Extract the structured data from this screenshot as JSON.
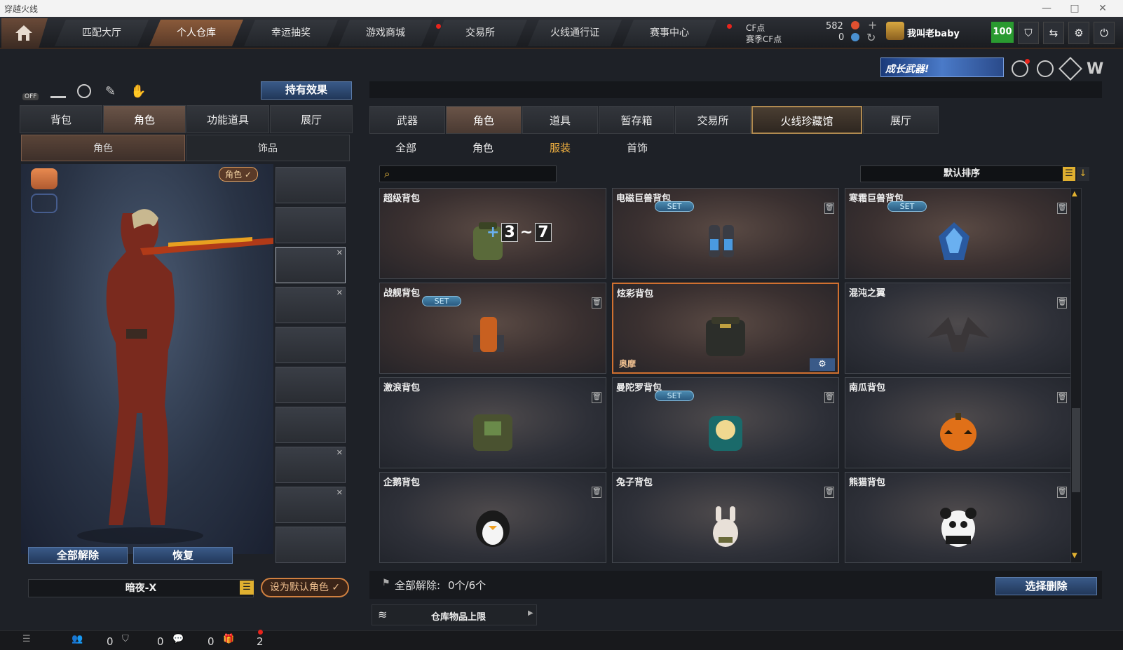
{
  "window": {
    "title": "穿越火线",
    "btn_min": "—",
    "btn_max": "□",
    "btn_close": "✕"
  },
  "nav": {
    "tabs": [
      "匹配大厅",
      "个人仓库",
      "幸运抽奖",
      "游戏商城",
      "交易所",
      "火线通行证",
      "赛事中心"
    ],
    "active": 1,
    "cf_label": "CF点",
    "cf_value": "582",
    "match_cf_label": "赛季CF点",
    "match_cf_value": "0",
    "plus": "+",
    "refresh": "↻",
    "username": "我叫老baby",
    "level": "100"
  },
  "banner": {
    "text": "成长武器!"
  },
  "left": {
    "holding_effect": "持有效果",
    "off_label": "OFF",
    "tabs": [
      "背包",
      "角色",
      "功能道具",
      "展厅"
    ],
    "active_tab": 1,
    "subtabs": [
      "角色",
      "饰品"
    ],
    "active_subtab": 0,
    "char_badge": "角色 ✓",
    "btn_release_all": "全部解除",
    "btn_restore": "恢复",
    "char_name": "暗夜-X",
    "btn_set_default": "设为默认角色 ✓",
    "slots": [
      {
        "x": false
      },
      {
        "x": false
      },
      {
        "x": true
      },
      {
        "x": true
      },
      {
        "x": false
      },
      {
        "x": false
      },
      {
        "x": false
      },
      {
        "x": true
      },
      {
        "x": true
      },
      {
        "x": false
      }
    ]
  },
  "right": {
    "tabs": [
      "武器",
      "角色",
      "道具",
      "暂存箱",
      "交易所",
      "火线珍藏馆",
      "展厅"
    ],
    "active_tab": 1,
    "gold_tab": 5,
    "filters": [
      "全部",
      "角色",
      "服装",
      "首饰"
    ],
    "active_filter": 2,
    "search_placeholder": "",
    "sort_label": "默认排序",
    "items": [
      {
        "name": "超级背包",
        "set": false,
        "del": false,
        "warm": true,
        "art": "bag-super-icon",
        "bag_a": "3",
        "bag_b": "7",
        "bag_tag": "BAG"
      },
      {
        "name": "电磁巨兽背包",
        "set": true,
        "del": true,
        "warm": true,
        "art": "bag-electro-icon"
      },
      {
        "name": "寒霜巨兽背包",
        "set": true,
        "del": true,
        "warm": true,
        "art": "bag-frost-icon"
      },
      {
        "name": "战舰背包",
        "set": true,
        "del": true,
        "warm": true,
        "art": "bag-warship-icon"
      },
      {
        "name": "炫彩背包",
        "set": false,
        "del": false,
        "warm": true,
        "selected": true,
        "art": "bag-colorful-icon",
        "tag": "奥摩"
      },
      {
        "name": "混沌之翼",
        "set": false,
        "del": true,
        "warm": false,
        "art": "wings-chaos-icon"
      },
      {
        "name": "激浪背包",
        "set": false,
        "del": true,
        "warm": false,
        "art": "bag-wave-icon"
      },
      {
        "name": "曼陀罗背包",
        "set": true,
        "del": true,
        "warm": false,
        "art": "bag-mandala-icon"
      },
      {
        "name": "南瓜背包",
        "set": false,
        "del": true,
        "warm": false,
        "art": "bag-pumpkin-icon"
      },
      {
        "name": "企鹅背包",
        "set": false,
        "del": true,
        "warm": false,
        "art": "bag-penguin-icon"
      },
      {
        "name": "兔子背包",
        "set": false,
        "del": true,
        "warm": false,
        "art": "bag-rabbit-icon"
      },
      {
        "name": "熊猫背包",
        "set": false,
        "del": true,
        "warm": false,
        "art": "bag-panda-icon"
      }
    ],
    "set_label": "SET",
    "release_all": "全部解除:",
    "release_count": "0个/6个",
    "btn_select_delete": "选择删除",
    "storage_limit": "仓库物品上限"
  },
  "status": {
    "v1": "0",
    "v2": "0",
    "v3": "0",
    "gift": "2"
  },
  "colors": {
    "accent": "#d07030",
    "gold": "#f0b040",
    "blue_btn": "#2a4a78"
  }
}
